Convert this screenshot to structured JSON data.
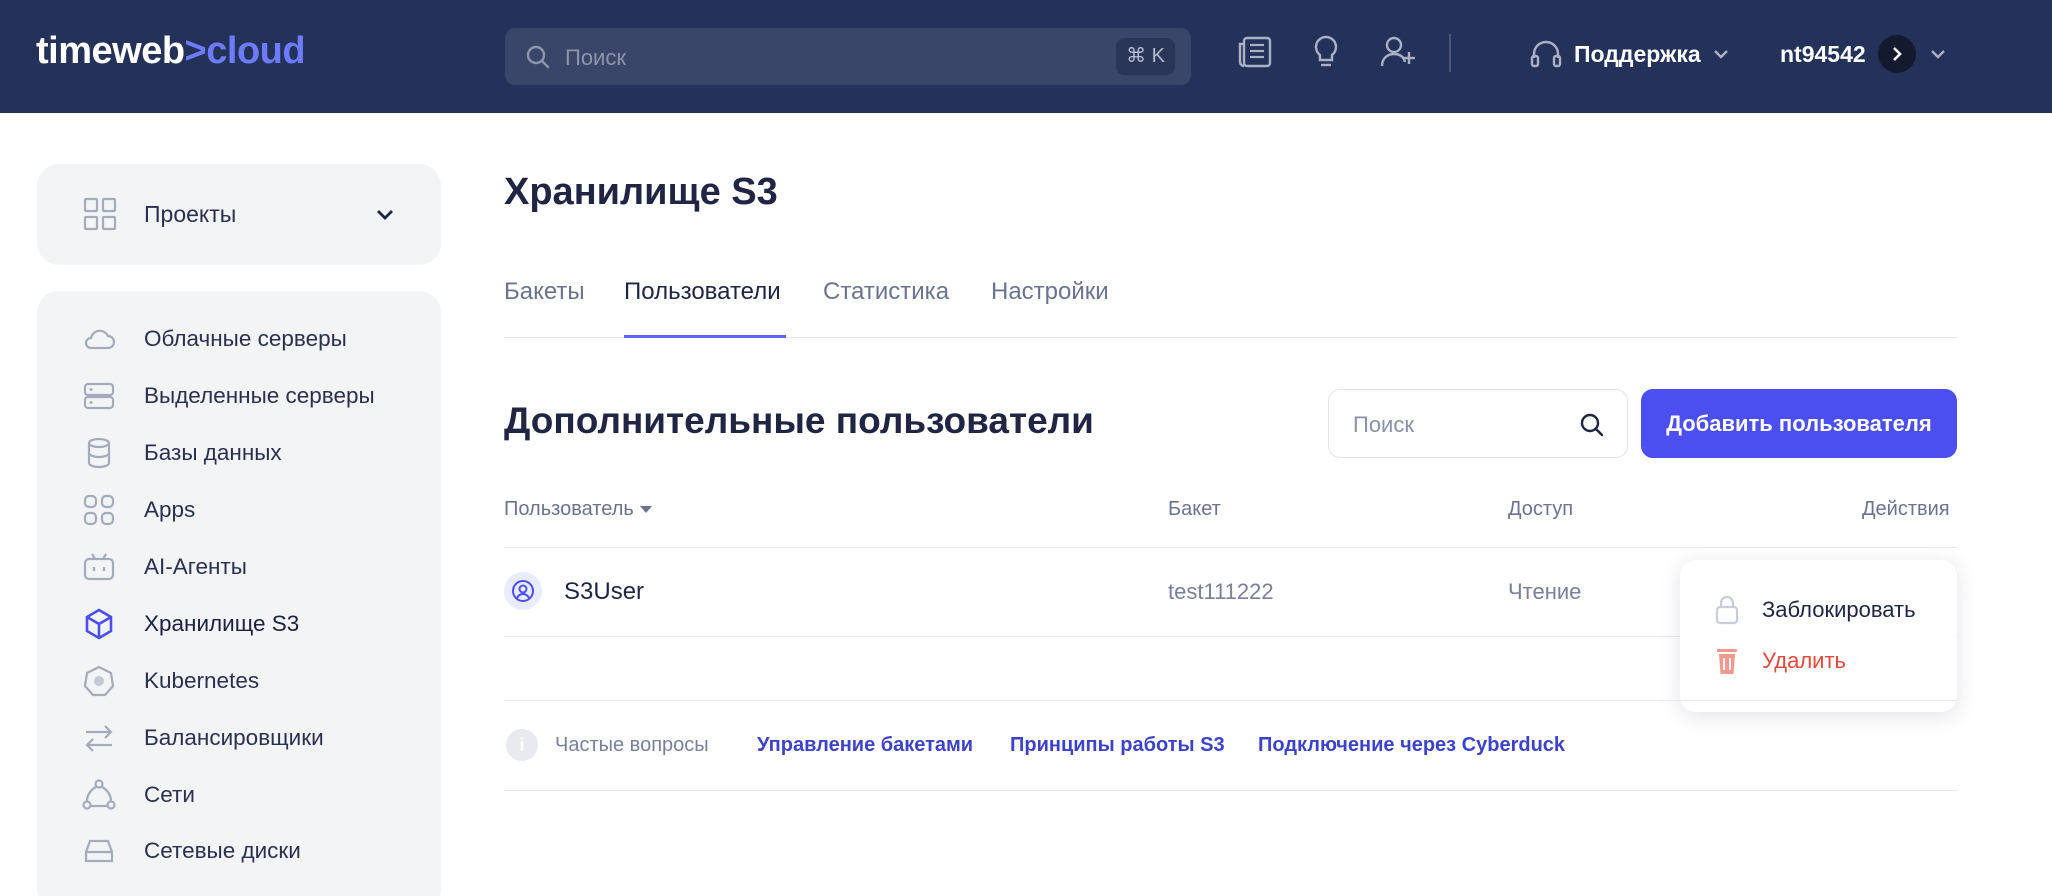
{
  "header": {
    "logo": {
      "part1": "timeweb",
      "separator": ">",
      "part2": "cloud"
    },
    "search": {
      "placeholder": "Поиск",
      "shortcut": "⌘ K"
    },
    "icons": [
      "news-icon",
      "lightbulb-icon",
      "add-user-icon"
    ],
    "support_label": "Поддержка",
    "account_name": "nt94542"
  },
  "sidebar": {
    "projects_label": "Проекты",
    "items": [
      {
        "label": "Облачные серверы",
        "icon": "cloud-icon"
      },
      {
        "label": "Выделенные серверы",
        "icon": "server-icon"
      },
      {
        "label": "Базы данных",
        "icon": "database-icon"
      },
      {
        "label": "Apps",
        "icon": "apps-grid-icon"
      },
      {
        "label": "AI-Агенты",
        "icon": "robot-icon"
      },
      {
        "label": "Хранилище S3",
        "icon": "cube-icon",
        "active": true
      },
      {
        "label": "Kubernetes",
        "icon": "kubernetes-icon"
      },
      {
        "label": "Балансировщики",
        "icon": "arrows-icon"
      },
      {
        "label": "Сети",
        "icon": "network-icon"
      },
      {
        "label": "Сетевые диски",
        "icon": "disk-icon"
      }
    ]
  },
  "main": {
    "page_title": "Хранилище S3",
    "tabs": [
      {
        "label": "Бакеты"
      },
      {
        "label": "Пользователи",
        "active": true
      },
      {
        "label": "Статистика"
      },
      {
        "label": "Настройки"
      }
    ],
    "section_title": "Дополнительные пользователи",
    "search_placeholder": "Поиск",
    "add_button": "Добавить пользователя",
    "table": {
      "columns": [
        "Пользователь",
        "Бакет",
        "Доступ",
        "Действия"
      ],
      "rows": [
        {
          "user": "S3User",
          "bucket": "test111222",
          "access": "Чтение"
        }
      ]
    },
    "actions_menu": {
      "block": "Заблокировать",
      "delete": "Удалить"
    },
    "faq": {
      "label": "Частые вопросы",
      "links": [
        "Управление бакетами",
        "Принципы работы S3",
        "Подключение через Cyberduck"
      ]
    }
  },
  "colors": {
    "header_bg": "#243259",
    "accent": "#4b4ff0",
    "danger": "#e04a3c",
    "sidebar_bg": "#f3f4f6"
  }
}
